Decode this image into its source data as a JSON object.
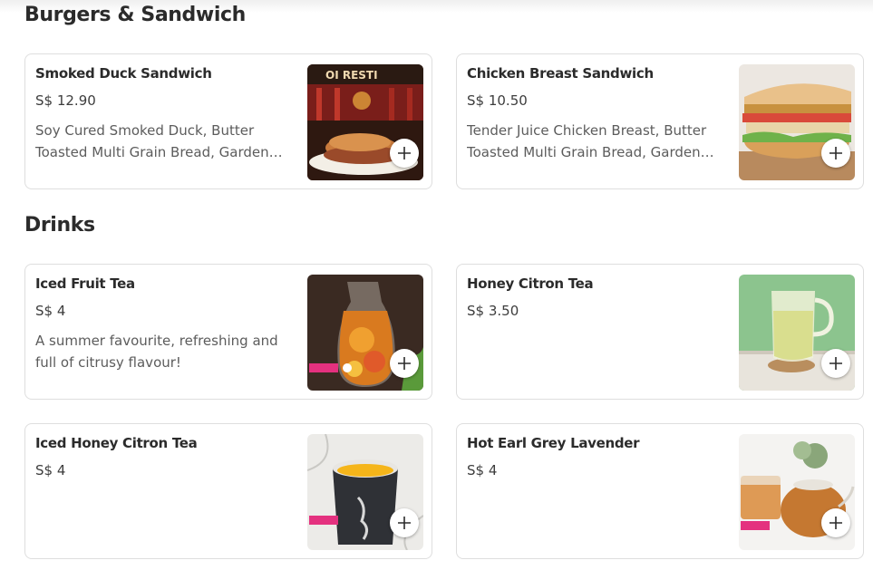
{
  "sections": [
    {
      "title": "Burgers & Sandwich",
      "items": [
        {
          "name": "Smoked Duck Sandwich",
          "price": "S$ 12.90",
          "description": "Soy Cured Smoked Duck, Butter Toasted Multi Grain Bread, Garden Greens and Tomato",
          "image": "smoked-duck-sandwich-photo"
        },
        {
          "name": "Chicken Breast Sandwich",
          "price": "S$ 10.50",
          "description": "Tender Juice Chicken Breast, Butter Toasted Multi Grain Bread, Garden Greens and Tomato",
          "image": "chicken-breast-sandwich-photo"
        }
      ]
    },
    {
      "title": "Drinks",
      "items": [
        {
          "name": "Iced Fruit Tea",
          "price": "S$ 4",
          "description": "A summer favourite, refreshing and full of citrusy flavour!",
          "image": "iced-fruit-tea-photo"
        },
        {
          "name": "Honey Citron Tea",
          "price": "S$ 3.50",
          "description": "",
          "image": "honey-citron-tea-photo"
        },
        {
          "name": "Iced Honey Citron Tea",
          "price": "S$ 4",
          "description": "",
          "image": "iced-honey-citron-tea-photo"
        },
        {
          "name": "Hot Earl Grey Lavender",
          "price": "S$ 4",
          "description": "",
          "image": "hot-earl-grey-lavender-photo"
        }
      ]
    }
  ],
  "add_icon": "plus-icon",
  "colors": {
    "title": "#2b2b2b",
    "text": "#3d3d3d",
    "description": "#5c5c5c",
    "card_border": "#dedede",
    "badge_pink": "#e4317f"
  }
}
